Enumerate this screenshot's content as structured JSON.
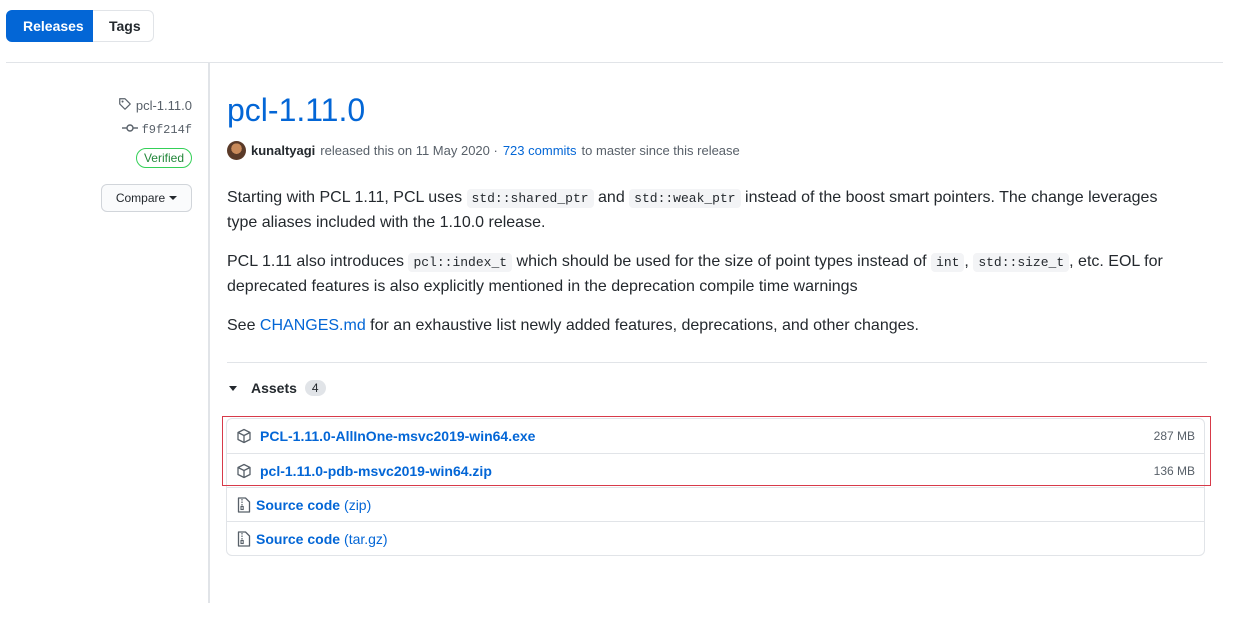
{
  "tabs": {
    "releases": "Releases",
    "tags": "Tags"
  },
  "sidebar": {
    "tag": "pcl-1.11.0",
    "commit": "f9f214f",
    "verified": "Verified",
    "compare": "Compare"
  },
  "release": {
    "title": "pcl-1.11.0",
    "author": "kunaltyagi",
    "released_text": "released this on 11 May 2020 ·",
    "commits_link": "723 commits",
    "since_text": "to master since this release"
  },
  "body": {
    "p1_a": "Starting with PCL 1.11, PCL uses",
    "p1_code1": "std::shared_ptr",
    "p1_b": "and",
    "p1_code2": "std::weak_ptr",
    "p1_c": "instead of the boost smart pointers. The change leverages type aliases included with the 1.10.0 release.",
    "p2_a": "PCL 1.11 also introduces",
    "p2_code1": "pcl::index_t",
    "p2_b": "which should be used for the size of point types instead of",
    "p2_code2": "int",
    "p2_c": ",",
    "p2_code3": "std::size_t",
    "p2_d": ", etc. EOL for deprecated features is also explicitly mentioned in the deprecation compile time warnings",
    "p3_a": "See",
    "p3_link": "CHANGES.md",
    "p3_b": "for an exhaustive list newly added features, deprecations, and other changes."
  },
  "assets": {
    "label": "Assets",
    "count": "4",
    "items": [
      {
        "name": "PCL-1.11.0-AllInOne-msvc2019-win64.exe",
        "size": "287 MB",
        "icon": "package-icon"
      },
      {
        "name": "pcl-1.11.0-pdb-msvc2019-win64.zip",
        "size": "136 MB",
        "icon": "package-icon"
      },
      {
        "name": "Source code",
        "suffix": "(zip)",
        "icon": "file-zip-icon"
      },
      {
        "name": "Source code",
        "suffix": "(tar.gz)",
        "icon": "file-zip-icon"
      }
    ]
  },
  "colors": {
    "accent": "#0366d6",
    "verified": "#22863a",
    "highlight": "#d73a49"
  }
}
